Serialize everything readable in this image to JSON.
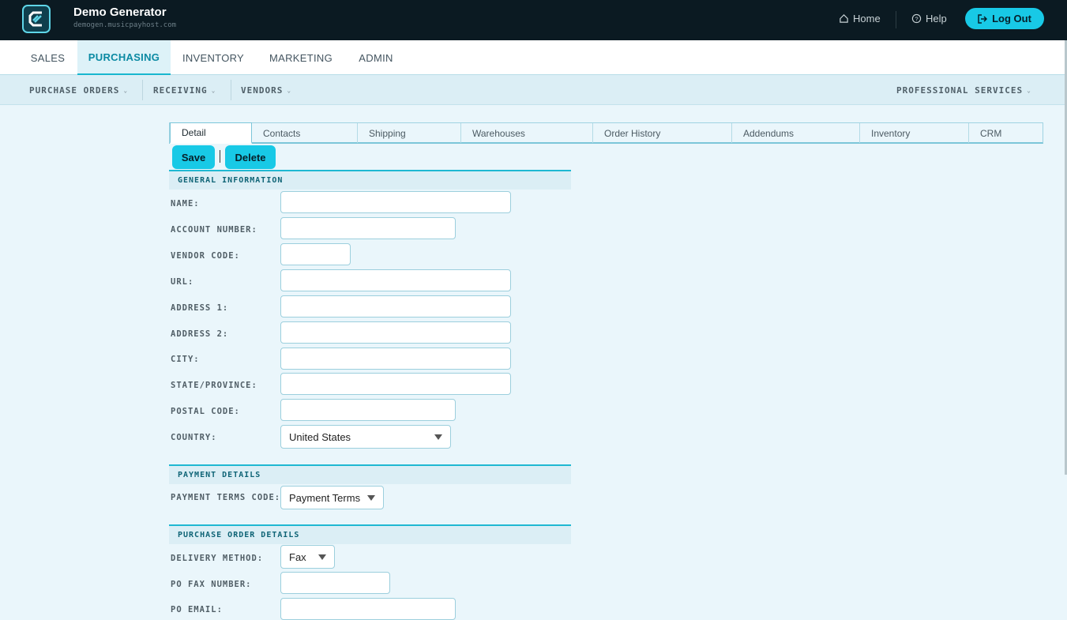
{
  "header": {
    "title": "Demo Generator",
    "subtitle": "demogen.musicpayhost.com",
    "home_label": "Home",
    "help_label": "Help",
    "logout_label": "Log Out"
  },
  "main_nav": {
    "tabs": [
      {
        "label": "SALES"
      },
      {
        "label": "PURCHASING"
      },
      {
        "label": "INVENTORY"
      },
      {
        "label": "MARKETING"
      },
      {
        "label": "ADMIN"
      }
    ],
    "active": "PURCHASING"
  },
  "sub_nav": {
    "items": [
      {
        "label": "PURCHASE ORDERS"
      },
      {
        "label": "RECEIVING"
      },
      {
        "label": "VENDORS"
      }
    ],
    "right_item": "PROFESSIONAL SERVICES"
  },
  "tabs": {
    "items": [
      {
        "label": "Detail"
      },
      {
        "label": "Contacts"
      },
      {
        "label": "Shipping"
      },
      {
        "label": "Warehouses"
      },
      {
        "label": "Order History"
      },
      {
        "label": "Addendums"
      },
      {
        "label": "Inventory"
      },
      {
        "label": "CRM"
      }
    ],
    "active": "Detail"
  },
  "actions": {
    "save_label": "Save",
    "delete_label": "Delete"
  },
  "general": {
    "heading": "GENERAL INFORMATION",
    "fields": {
      "name": {
        "label": "NAME:",
        "value": ""
      },
      "account_number": {
        "label": "ACCOUNT NUMBER:",
        "value": ""
      },
      "vendor_code": {
        "label": "VENDOR CODE:",
        "value": ""
      },
      "url": {
        "label": "URL:",
        "value": ""
      },
      "address1": {
        "label": "ADDRESS 1:",
        "value": ""
      },
      "address2": {
        "label": "ADDRESS 2:",
        "value": ""
      },
      "city": {
        "label": "CITY:",
        "value": ""
      },
      "state": {
        "label": "STATE/PROVINCE:",
        "value": ""
      },
      "postal": {
        "label": "POSTAL CODE:",
        "value": ""
      },
      "country": {
        "label": "COUNTRY:",
        "value": "United States"
      }
    }
  },
  "payment": {
    "heading": "PAYMENT DETAILS",
    "terms_label": "PAYMENT TERMS CODE:",
    "terms_value": "Payment Terms"
  },
  "po_details": {
    "heading": "PURCHASE ORDER DETAILS",
    "delivery_label": "DELIVERY METHOD:",
    "delivery_value": "Fax",
    "fax_label": "PO FAX NUMBER:",
    "fax_value": "",
    "email_label": "PO EMAIL:",
    "email_value": ""
  },
  "colors": {
    "accent": "#18c9e6",
    "header_bg": "#0b1a22",
    "page_bg": "#eaf6fb"
  }
}
